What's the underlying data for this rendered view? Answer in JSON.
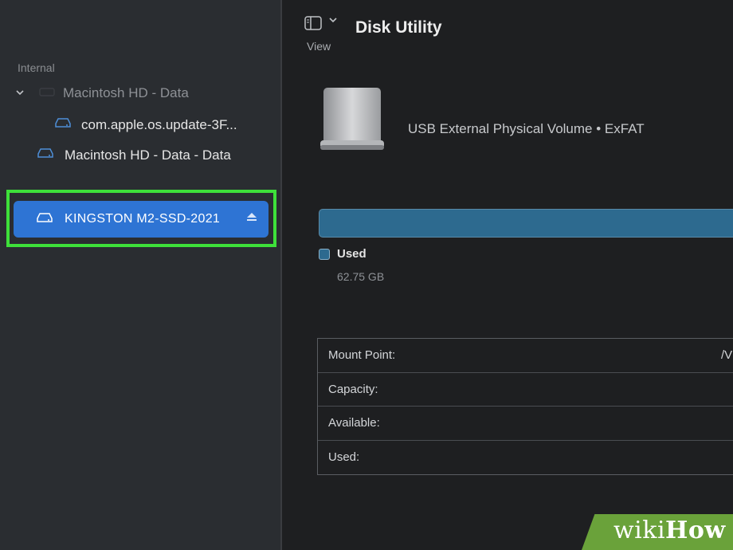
{
  "sidebar": {
    "section_internal": "Internal",
    "items": [
      {
        "label": "Macintosh HD - Data"
      },
      {
        "label": "com.apple.os.update-3F..."
      },
      {
        "label": "Macintosh HD - Data - Data"
      }
    ],
    "selected": {
      "label": "KINGSTON M2-SSD-2021",
      "icon": "external-disk-icon",
      "eject_icon": "eject-icon"
    }
  },
  "toolbar": {
    "view_label": "View",
    "view_icon": "sidebar-toggle-icon",
    "title": "Disk Utility"
  },
  "volume": {
    "description": "USB External Physical Volume • ExFAT",
    "usage_color": "#2d6a8f",
    "used_label": "Used",
    "used_value": "62.75 GB"
  },
  "info": {
    "rows": [
      {
        "label": "Mount Point:",
        "value": "/V"
      },
      {
        "label": "Capacity:",
        "value": ""
      },
      {
        "label": "Available:",
        "value": ""
      },
      {
        "label": "Used:",
        "value": ""
      }
    ]
  },
  "watermark": {
    "text_wiki": "wiki",
    "text_how": "How"
  },
  "colors": {
    "selection": "#2e74d4",
    "highlight": "#3ee03a"
  }
}
